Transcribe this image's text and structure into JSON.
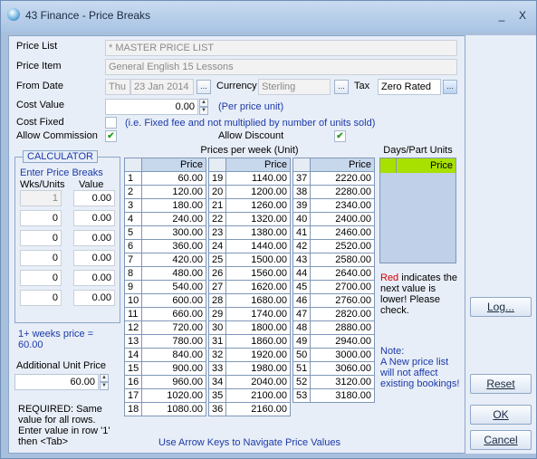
{
  "window": {
    "title": "43 Finance - Price Breaks",
    "minimize": "_",
    "close": "X"
  },
  "form": {
    "price_list_label": "Price List",
    "price_list_value": "* MASTER PRICE LIST",
    "price_item_label": "Price Item",
    "price_item_value": "General English 15 Lessons",
    "from_date_label": "From Date",
    "from_date_day": "Thu",
    "from_date_value": "23 Jan 2014",
    "currency_label": "Currency",
    "currency_value": "Sterling",
    "tax_label": "Tax",
    "tax_value": "Zero Rated",
    "cost_value_label": "Cost Value",
    "cost_value": "0.00",
    "cost_value_note": "(Per price unit)",
    "cost_fixed_label": "Cost Fixed",
    "cost_fixed_note": "(i.e. Fixed fee and not multiplied by number of units sold)",
    "allow_commission_label": "Allow Commission",
    "allow_discount_label": "Allow Discount",
    "ellipsis": "...",
    "check": "✔"
  },
  "calculator": {
    "title": "CALCULATOR",
    "heading": "Enter Price Breaks",
    "col_units": "Wks/Units",
    "col_value": "Value",
    "rows": [
      {
        "u": "1",
        "v": "0.00"
      },
      {
        "u": "0",
        "v": "0.00"
      },
      {
        "u": "0",
        "v": "0.00"
      },
      {
        "u": "0",
        "v": "0.00"
      },
      {
        "u": "0",
        "v": "0.00"
      },
      {
        "u": "0",
        "v": "0.00"
      }
    ],
    "summary": "1+ weeks price = 60.00",
    "additional_label": "Additional Unit Price",
    "additional_value": "60.00",
    "required_text": "REQUIRED: Same value for all rows.  Enter value in row '1' then <Tab>"
  },
  "prices": {
    "title": "Prices per week (Unit)",
    "price_header": "Price",
    "col1": [
      [
        "1",
        "60.00"
      ],
      [
        "2",
        "120.00"
      ],
      [
        "3",
        "180.00"
      ],
      [
        "4",
        "240.00"
      ],
      [
        "5",
        "300.00"
      ],
      [
        "6",
        "360.00"
      ],
      [
        "7",
        "420.00"
      ],
      [
        "8",
        "480.00"
      ],
      [
        "9",
        "540.00"
      ],
      [
        "10",
        "600.00"
      ],
      [
        "11",
        "660.00"
      ],
      [
        "12",
        "720.00"
      ],
      [
        "13",
        "780.00"
      ],
      [
        "14",
        "840.00"
      ],
      [
        "15",
        "900.00"
      ],
      [
        "16",
        "960.00"
      ],
      [
        "17",
        "1020.00"
      ],
      [
        "18",
        "1080.00"
      ]
    ],
    "col2": [
      [
        "19",
        "1140.00"
      ],
      [
        "20",
        "1200.00"
      ],
      [
        "21",
        "1260.00"
      ],
      [
        "22",
        "1320.00"
      ],
      [
        "23",
        "1380.00"
      ],
      [
        "24",
        "1440.00"
      ],
      [
        "25",
        "1500.00"
      ],
      [
        "26",
        "1560.00"
      ],
      [
        "27",
        "1620.00"
      ],
      [
        "28",
        "1680.00"
      ],
      [
        "29",
        "1740.00"
      ],
      [
        "30",
        "1800.00"
      ],
      [
        "31",
        "1860.00"
      ],
      [
        "32",
        "1920.00"
      ],
      [
        "33",
        "1980.00"
      ],
      [
        "34",
        "2040.00"
      ],
      [
        "35",
        "2100.00"
      ],
      [
        "36",
        "2160.00"
      ]
    ],
    "col3": [
      [
        "37",
        "2220.00"
      ],
      [
        "38",
        "2280.00"
      ],
      [
        "39",
        "2340.00"
      ],
      [
        "40",
        "2400.00"
      ],
      [
        "41",
        "2460.00"
      ],
      [
        "42",
        "2520.00"
      ],
      [
        "43",
        "2580.00"
      ],
      [
        "44",
        "2640.00"
      ],
      [
        "45",
        "2700.00"
      ],
      [
        "46",
        "2760.00"
      ],
      [
        "47",
        "2820.00"
      ],
      [
        "48",
        "2880.00"
      ],
      [
        "49",
        "2940.00"
      ],
      [
        "50",
        "3000.00"
      ],
      [
        "51",
        "3060.00"
      ],
      [
        "52",
        "3120.00"
      ],
      [
        "53",
        "3180.00"
      ]
    ],
    "status": "Use Arrow Keys to Navigate Price Values"
  },
  "days_part": {
    "title": "Days/Part Units",
    "price_header": "Price",
    "red_word": "Red",
    "red_text": " indicates the next value is lower!  Please check.",
    "note_title": "Note:",
    "note_text": "A New price list will not affect existing bookings!"
  },
  "buttons": {
    "log": "Log...",
    "reset": "Reset",
    "ok": "OK",
    "cancel": "Cancel"
  },
  "colors": {
    "accent_blue": "#1c3aa8",
    "warning_red": "#d00000",
    "highlight_green": "#a8e000"
  }
}
